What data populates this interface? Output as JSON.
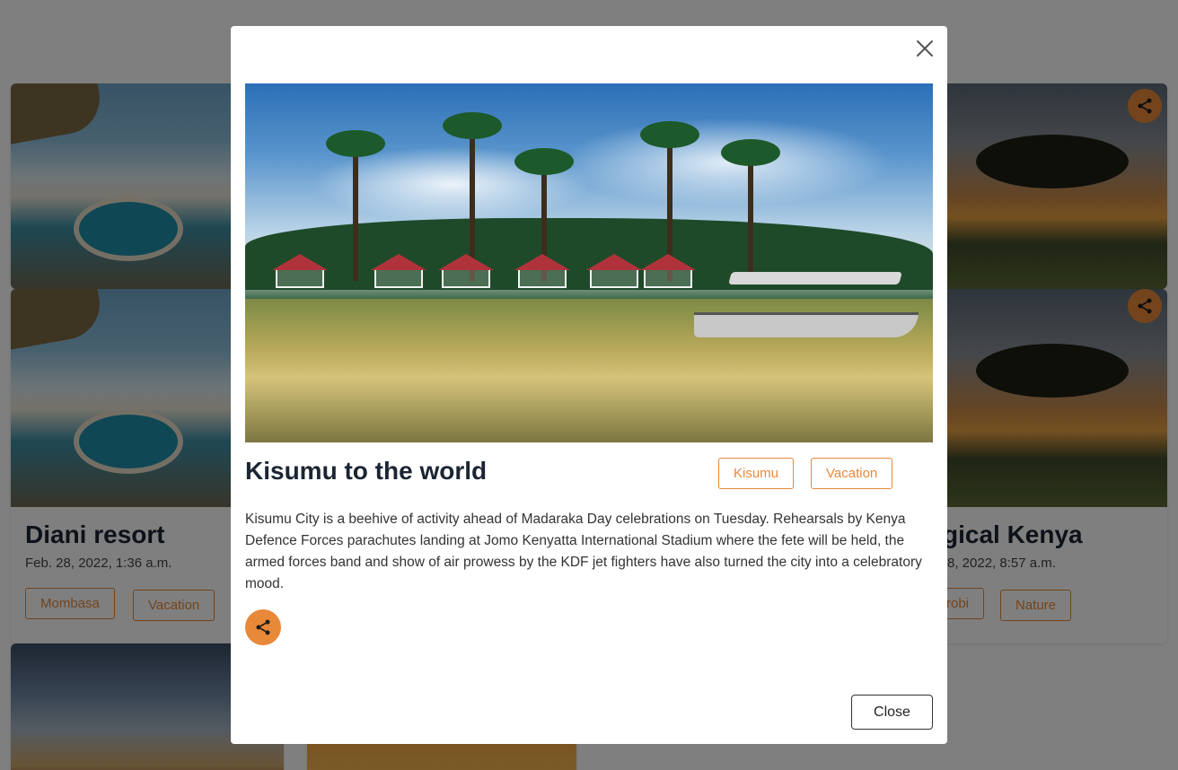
{
  "cards": {
    "diani": {
      "title": "Diani resort",
      "date": "Feb. 28, 2022, 1:36 a.m.",
      "tags": [
        "Mombasa",
        "Vacation"
      ]
    },
    "magical": {
      "title_partial": "gical Kenya",
      "date_partial": "8, 2022, 8:57 a.m.",
      "tags_partial": [
        "robi",
        "Nature"
      ]
    }
  },
  "modal": {
    "title": "Kisumu to the world",
    "tags": [
      "Kisumu",
      "Vacation"
    ],
    "description": "Kisumu City is a beehive of activity ahead of Madaraka Day celebrations on Tuesday. Rehearsals by Kenya Defence Forces parachutes landing at Jomo Kenyatta International Stadium where the fete will be held, the armed forces band and show of air prowess by the KDF jet fighters have also turned the city into a celebratory mood.",
    "close_label": "Close"
  },
  "colors": {
    "accent": "#e8893a",
    "title": "#1b2533",
    "overlay": "rgba(0,0,0,0.5)"
  },
  "icons": {
    "share": "share-icon",
    "close": "close-icon"
  }
}
